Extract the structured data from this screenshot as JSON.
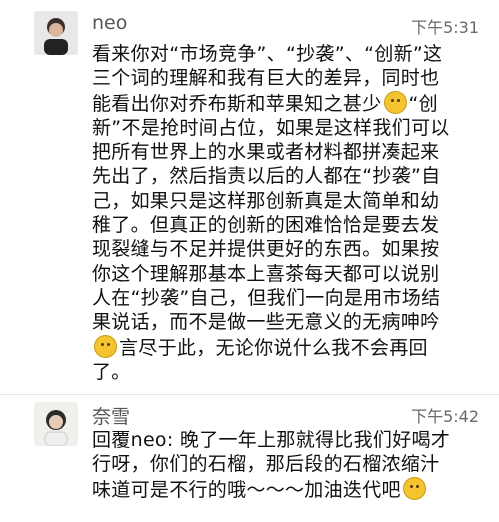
{
  "messages": [
    {
      "sender": "neo",
      "time": "下午5:31",
      "lines": [
        "看来你对“市场竞争”、“抄袭”、“创新”这",
        "三个词的理解和我有巨大的差异，同时也",
        "能看出你对乔布斯和苹果知之甚少",
        "新”不是抢时间占位，如果是这样我们可以",
        "把所有世界上的水果或者材料都拼凑起来",
        "先出了，然后指责以后的人都在“抄袭”自",
        "己，如果只是这样那创新真是太简单和幼",
        "稚了。但真正的创新的困难恰恰是要去发",
        "现裂缝与不足并提供更好的东西。如果按",
        "你这个理解那基本上喜茶每天都可以说别",
        "人在“抄袭”自己，但我们一向是用市场结",
        "果说话，而不是做一些无意义的无病呻吟",
        "言尽于此，无论你说什么我不会再回",
        "了。"
      ],
      "line3_tail": "“创"
    },
    {
      "sender": "奈雪",
      "time": "下午5:42",
      "lines": [
        "回覆neo: 晚了一年上那就得比我们好喝才",
        "行呀，你们的石榴，那后段的石榴浓缩汁",
        "味道可是不行的哦～～～加油迭代吧"
      ]
    }
  ],
  "icons": [
    "avatar",
    "thinking-emoji",
    "smile-emoji",
    "smirk-emoji"
  ]
}
